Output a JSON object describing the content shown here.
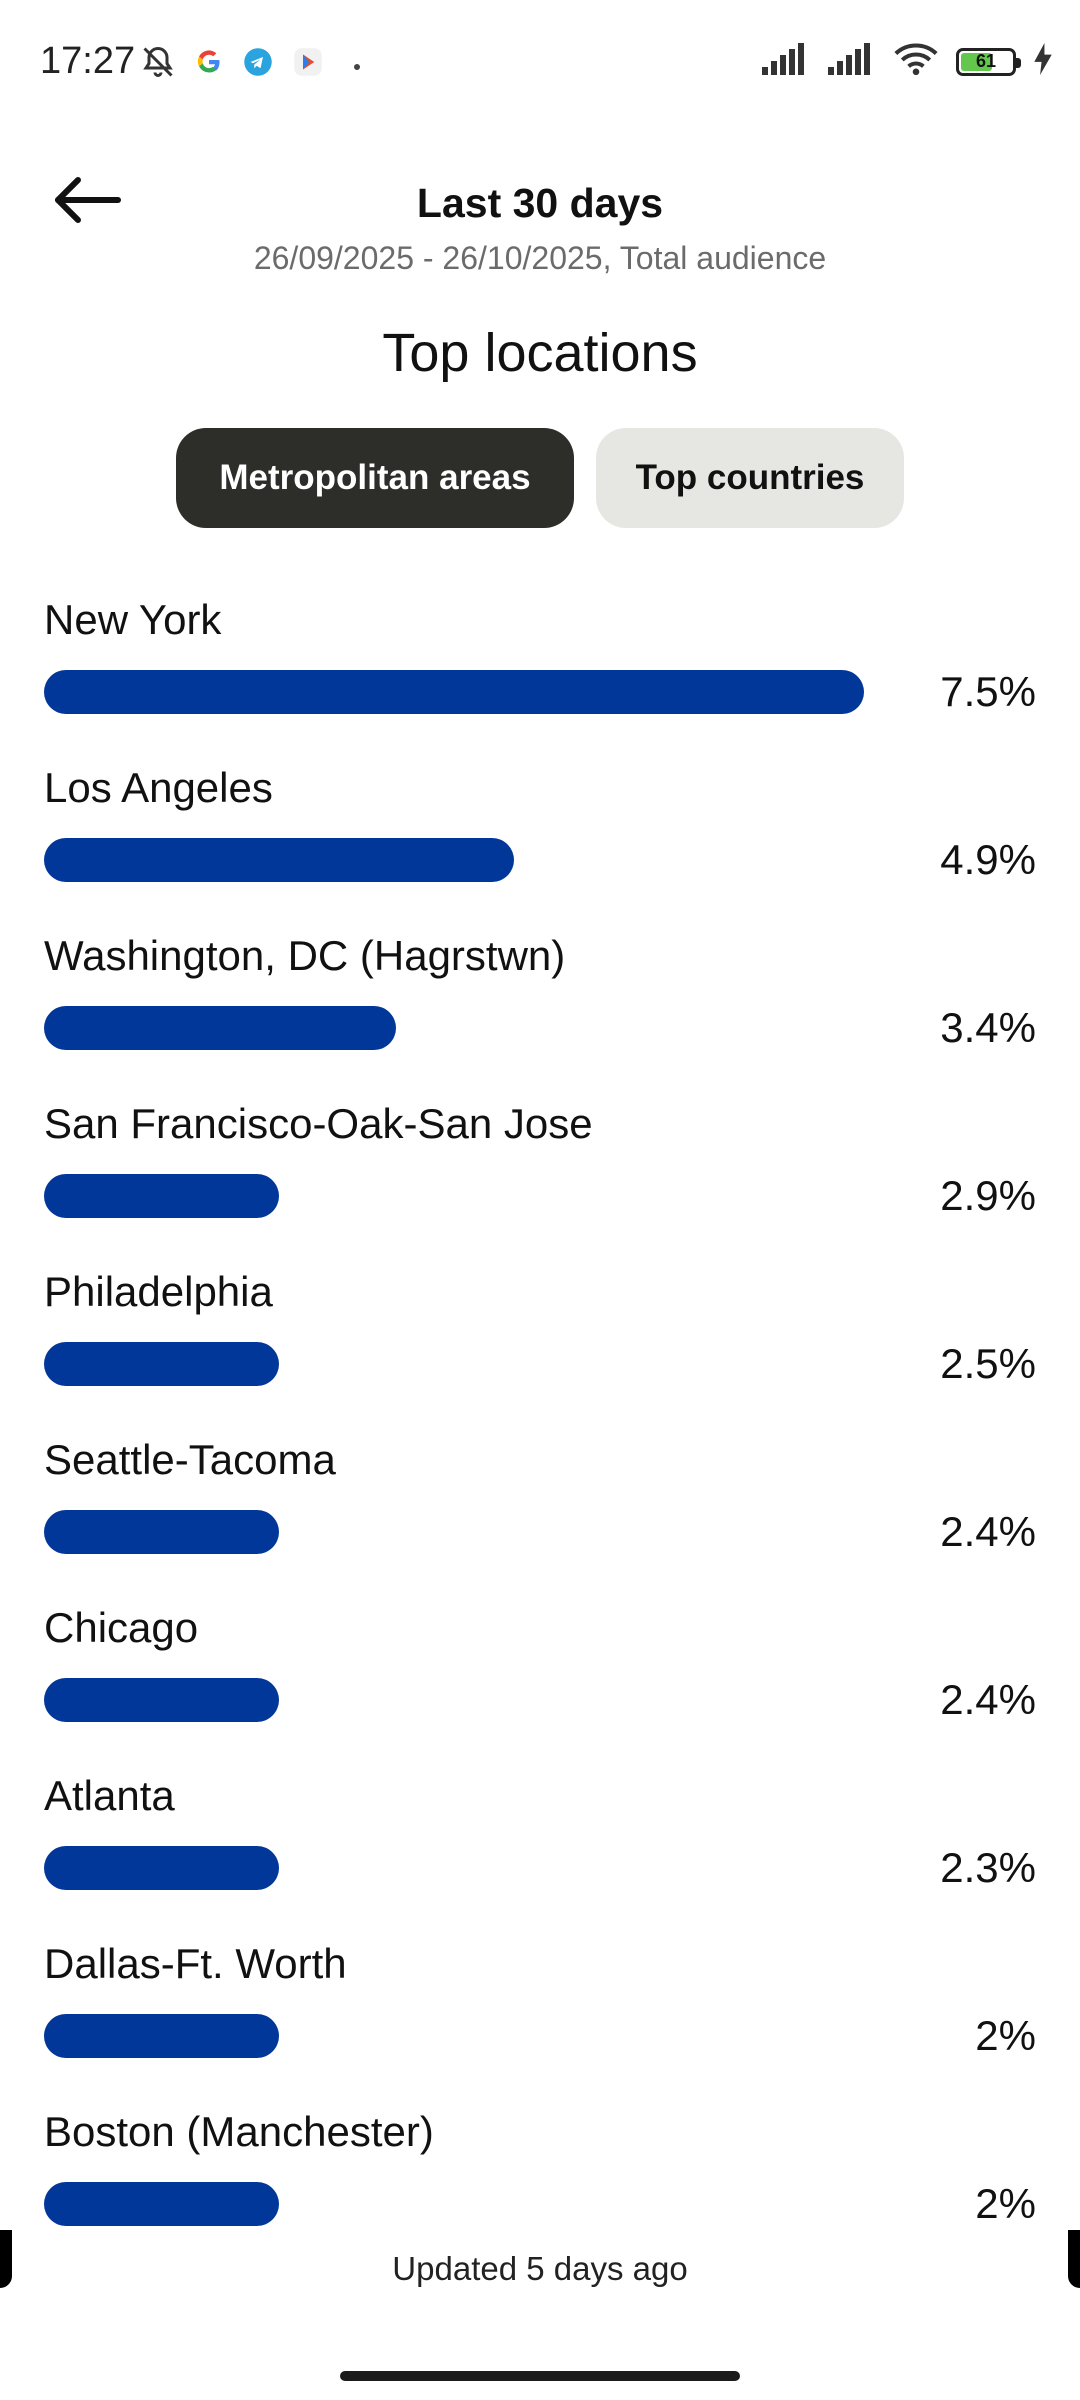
{
  "status_bar": {
    "time": "17:27",
    "icons": [
      "notifications-off-icon",
      "google-icon",
      "telegram-icon",
      "play-icon",
      "dot-icon"
    ],
    "right_icons": [
      "signal-icon",
      "signal-icon",
      "wifi-icon",
      "battery-icon",
      "charging-icon"
    ],
    "battery_level": "61"
  },
  "header": {
    "title": "Last 30 days",
    "subtitle": "26/09/2025 - 26/10/2025, Total audience",
    "back_icon": "arrow-left-icon"
  },
  "section_title": "Top locations",
  "tabs": [
    {
      "label": "Metropolitan areas",
      "active": true
    },
    {
      "label": "Top countries",
      "active": false
    }
  ],
  "bar_color": "#003799",
  "locations": [
    {
      "name": "New York",
      "percent_label": "7.5%",
      "bar_fill": 1.0
    },
    {
      "name": "Los Angeles",
      "percent_label": "4.9%",
      "bar_fill": 0.573
    },
    {
      "name": "Washington, DC (Hagrstwn)",
      "percent_label": "3.4%",
      "bar_fill": 0.429
    },
    {
      "name": "San Francisco-Oak-San Jose",
      "percent_label": "2.9%",
      "bar_fill": 0.287
    },
    {
      "name": "Philadelphia",
      "percent_label": "2.5%",
      "bar_fill": 0.287
    },
    {
      "name": "Seattle-Tacoma",
      "percent_label": "2.4%",
      "bar_fill": 0.287
    },
    {
      "name": "Chicago",
      "percent_label": "2.4%",
      "bar_fill": 0.287
    },
    {
      "name": "Atlanta",
      "percent_label": "2.3%",
      "bar_fill": 0.287
    },
    {
      "name": "Dallas-Ft. Worth",
      "percent_label": "2%",
      "bar_fill": 0.287
    },
    {
      "name": "Boston (Manchester)",
      "percent_label": "2%",
      "bar_fill": 0.287
    }
  ],
  "footer": {
    "updated": "Updated 5 days ago"
  }
}
